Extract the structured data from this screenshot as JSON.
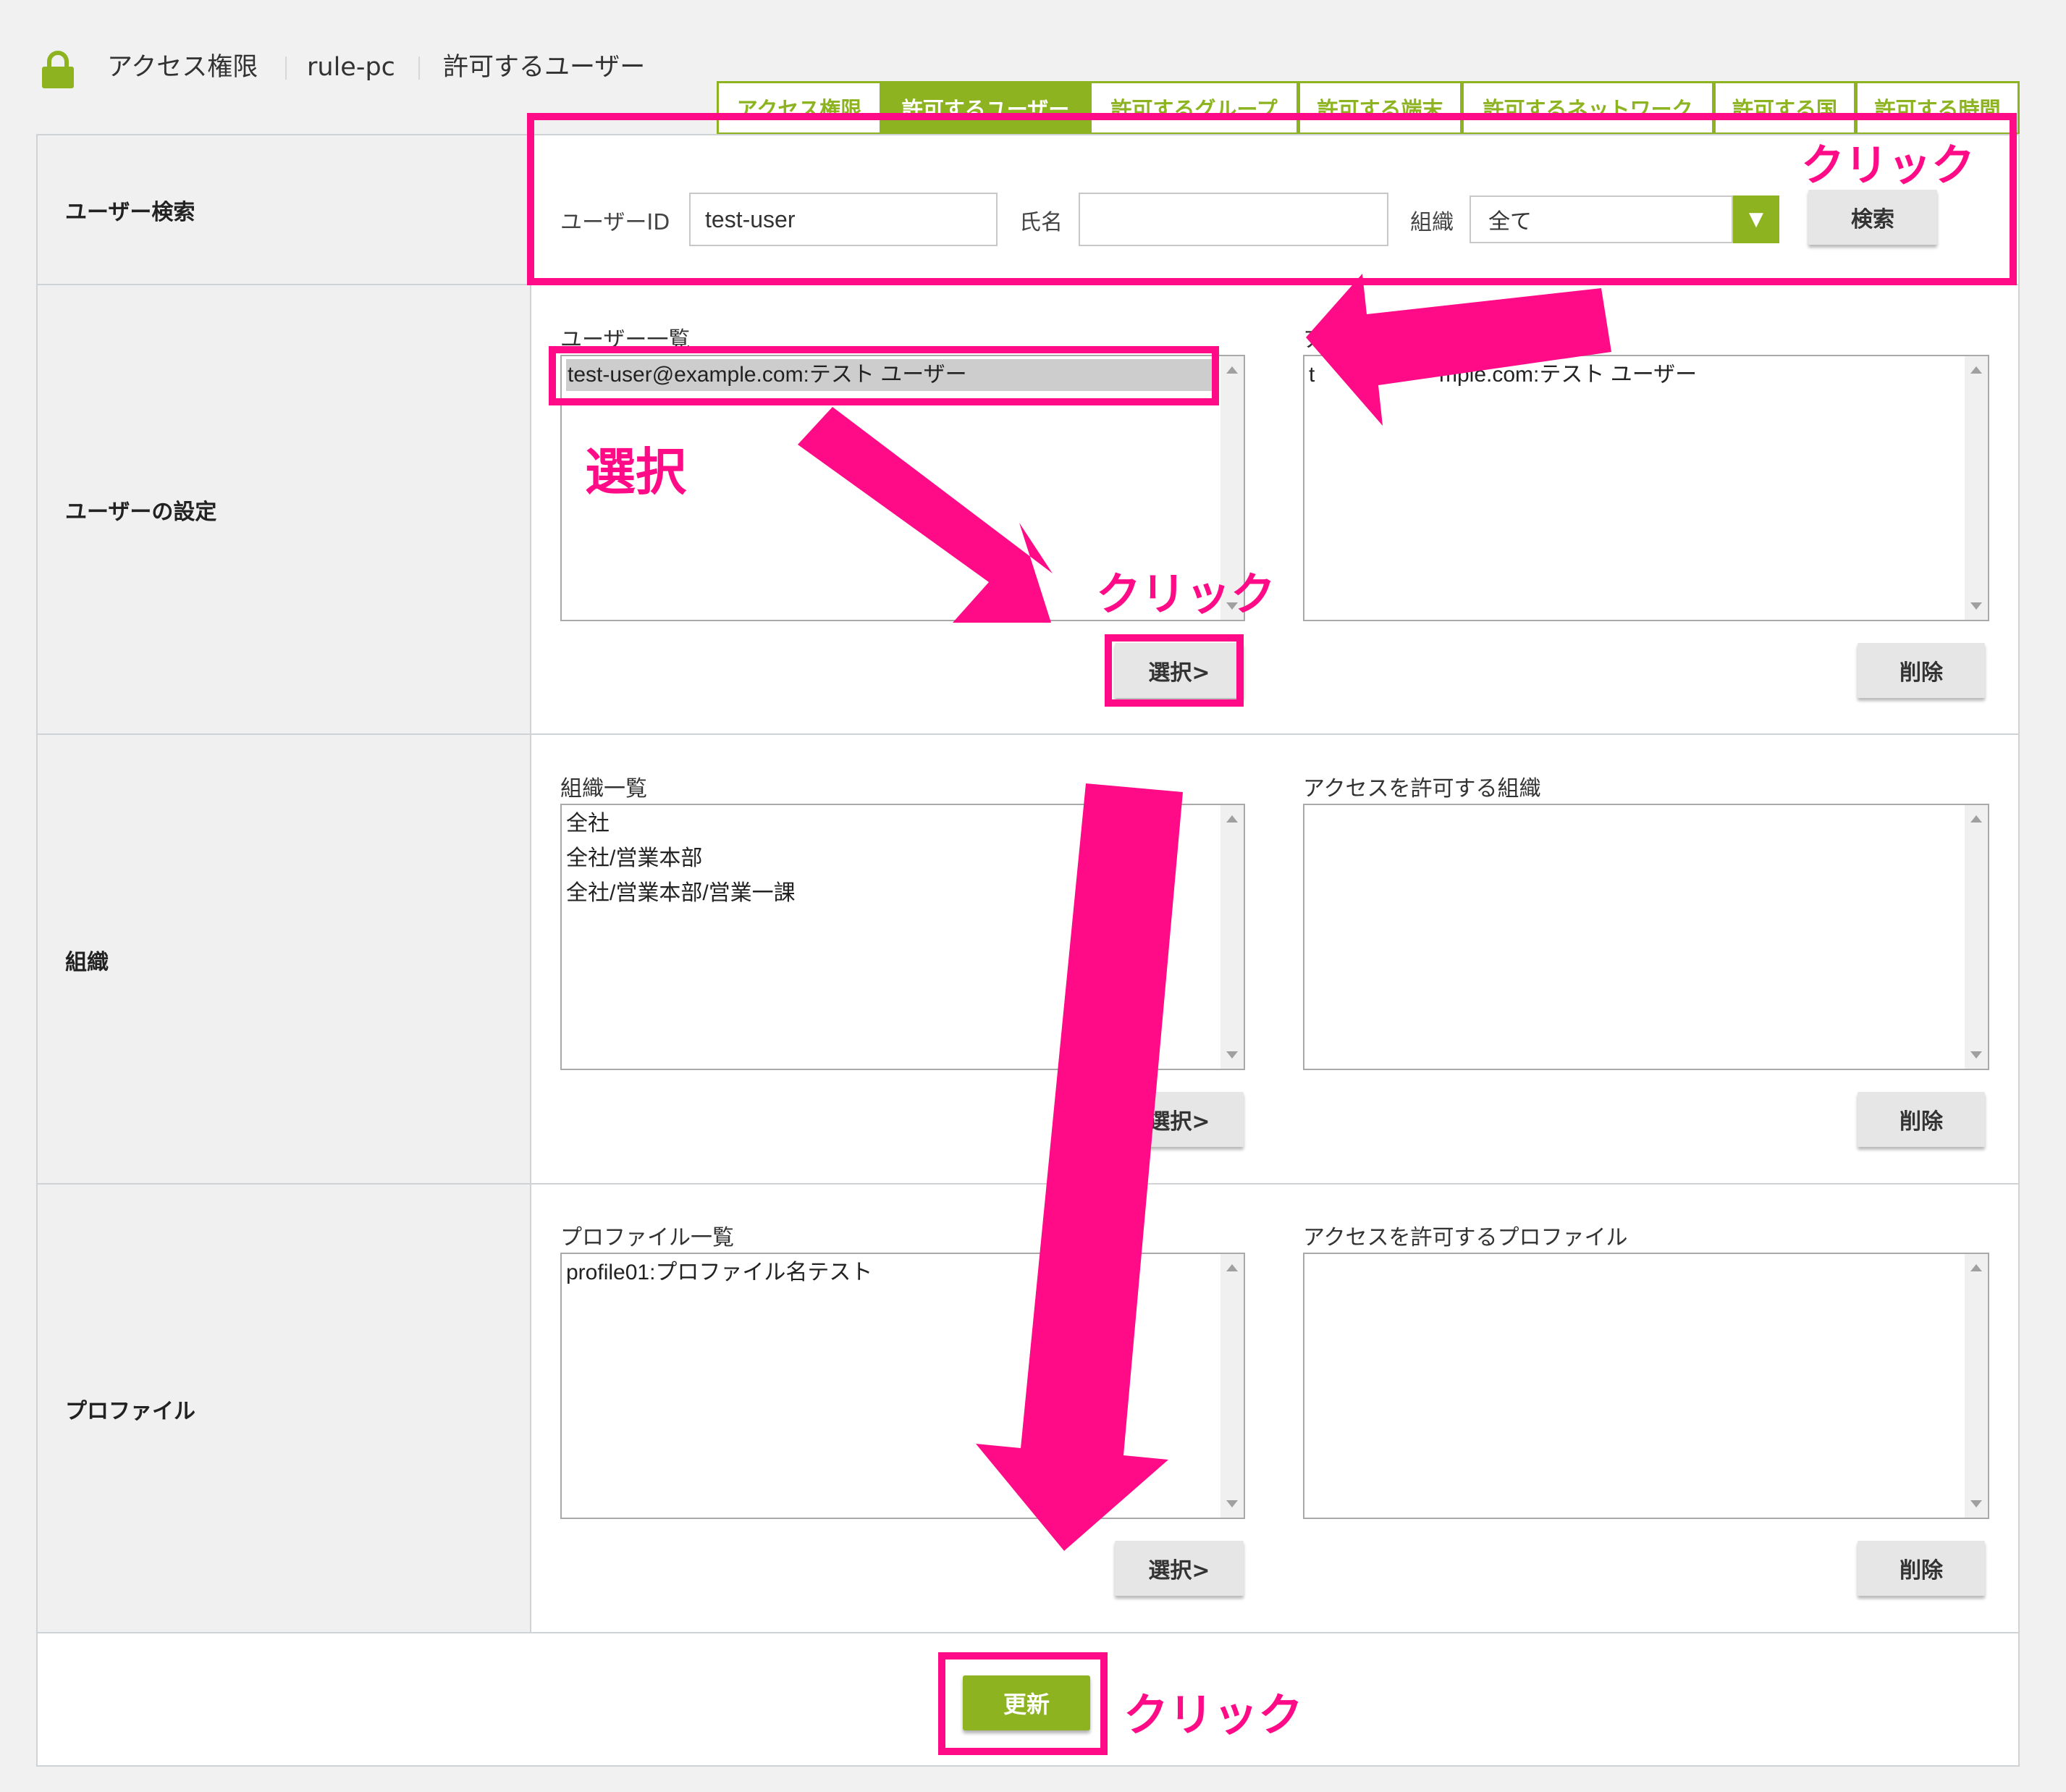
{
  "header": {
    "crumbs": [
      "アクセス権限",
      "rule-pc",
      "許可するユーザー"
    ],
    "tabs": [
      "アクセス権限",
      "許可するユーザー",
      "許可するグループ",
      "許可する端末",
      "許可するネットワーク",
      "許可する国",
      "許可する時間"
    ],
    "active_tab": "許可するユーザー"
  },
  "search": {
    "row_label": "ユーザー検索",
    "user_id_label": "ユーザーID",
    "user_id_value": "test-user",
    "name_label": "氏名",
    "name_value": "",
    "org_label": "組織",
    "org_selected": "全て",
    "search_button": "検索"
  },
  "user_settings": {
    "row_label": "ユーザーの設定",
    "list_title": "ユーザー一覧",
    "list_items": [
      "test-user@example.com:テスト ユーザー"
    ],
    "target_title": "ア",
    "target_items_fragments": [
      "t",
      "mple.com:テスト ユーザー"
    ],
    "select_button": "選択>",
    "delete_button": "削除"
  },
  "organization": {
    "row_label": "組織",
    "list_title": "組織一覧",
    "list_items": [
      "全社",
      "全社/営業本部",
      "全社/営業本部/営業一課"
    ],
    "target_title": "アクセスを許可する組織",
    "target_items": [],
    "select_button": "選択>",
    "delete_button": "削除"
  },
  "profile": {
    "row_label": "プロファイル",
    "list_title": "プロファイル一覧",
    "list_items": [
      "profile01:プロファイル名テスト"
    ],
    "target_title": "アクセスを許可するプロファイル",
    "target_items": [],
    "select_button": "選択>",
    "delete_button": "削除"
  },
  "footer": {
    "update_button": "更新"
  },
  "annotations": {
    "click_search": "クリック",
    "select_label": "選択",
    "click_select": "クリック",
    "click_update": "クリック"
  },
  "colors": {
    "accent_green": "#8db321",
    "annotation_pink": "#ff0a87"
  },
  "icons": [
    "lock-icon",
    "dropdown-arrow-icon"
  ]
}
